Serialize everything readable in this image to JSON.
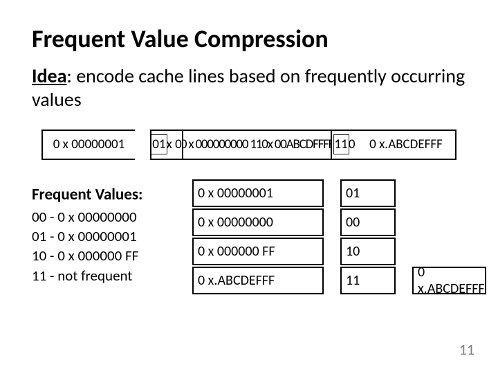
{
  "title": "Frequent Value Compression",
  "idea": {
    "label": "Idea",
    "text": ": encode cache lines based on frequently occurring values"
  },
  "cache_line": {
    "cell0": "0 x 00000001",
    "cell1_a": "01",
    "cell1_b": "x 0",
    "cell2": "0 x 000000000 110x 00ABCDFFFF",
    "cell3_a": "11",
    "cell3_b": "0",
    "cell4": "0 x.ABCDEFFF"
  },
  "fv": {
    "heading": "Frequent Values:",
    "rows": [
      "00 - 0 x 00000000",
      "01 - 0 x 00000001",
      "10 - 0 x 000000 FF",
      "11 - not frequent"
    ]
  },
  "table": {
    "rows": [
      {
        "val": "0 x 00000001",
        "code": "01",
        "extra": ""
      },
      {
        "val": "0 x 00000000",
        "code": "00",
        "extra": ""
      },
      {
        "val": "0 x 000000 FF",
        "code": "10",
        "extra": ""
      },
      {
        "val": "0 x.ABCDEFFF",
        "code": "11",
        "extra": "0 x.ABCDEFFF"
      }
    ]
  },
  "page_number": "11"
}
